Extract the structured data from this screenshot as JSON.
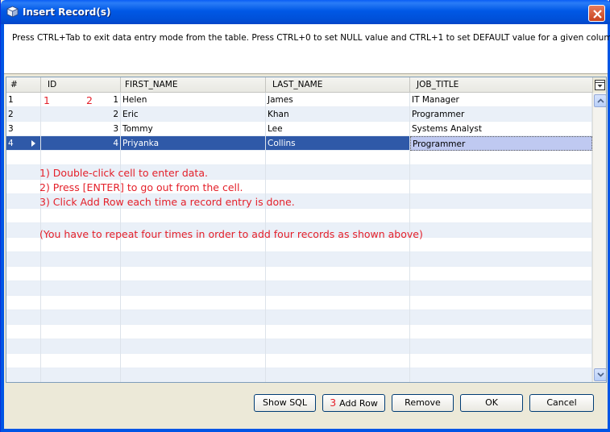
{
  "window": {
    "title": "Insert Record(s)",
    "icon": "cube-icon"
  },
  "info": {
    "text": "Press CTRL+Tab to exit data entry mode from the table. Press CTRL+0 to set NULL value and CTRL+1 to set DEFAULT value for a given column."
  },
  "table": {
    "columns": [
      "#",
      "ID",
      "FIRST_NAME",
      "LAST_NAME",
      "JOB_TITLE"
    ],
    "rows": [
      {
        "num": "1",
        "id": "1",
        "first": "Helen",
        "last": "James",
        "job": "IT Manager"
      },
      {
        "num": "2",
        "id": "2",
        "first": "Eric",
        "last": "Khan",
        "job": "Programmer"
      },
      {
        "num": "3",
        "id": "3",
        "first": "Tommy",
        "last": "Lee",
        "job": "Systems Analyst"
      },
      {
        "num": "4",
        "id": "4",
        "first": "Priyanka",
        "last": "Collins",
        "job": "Programmer"
      }
    ],
    "selected_row": 4
  },
  "annotations": {
    "mark1": "1",
    "mark2": "2",
    "step1": "1) Double-click cell to enter data.",
    "step2": "2) Press [ENTER] to go out from the cell.",
    "step3": "3) Click Add Row each time a record entry is done.",
    "note": "(You have to repeat four times in order to add four records as shown above)",
    "mark3": "3"
  },
  "buttons": {
    "show_sql": "Show SQL",
    "add_row": "Add Row",
    "remove": "Remove",
    "ok": "OK",
    "cancel": "Cancel"
  },
  "colors": {
    "titlebar": "#0058e6",
    "selection": "#2f59a8",
    "annotation": "#e4202a"
  }
}
